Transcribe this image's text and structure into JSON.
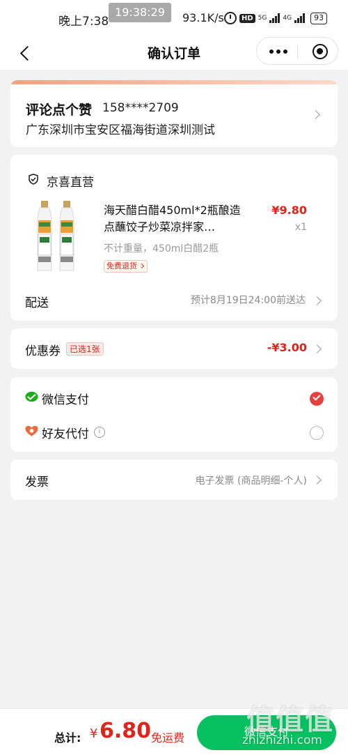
{
  "status_bar": {
    "time": "晚上7:38",
    "recording_badge": "19:38:29",
    "net_speed": "93.1K/s",
    "hd_label": "HD",
    "network_5g": "5G",
    "network_4g": "4G",
    "battery": "93",
    "icons": [
      "alarm-icon",
      "hd-icon",
      "signal-icon",
      "battery-icon"
    ]
  },
  "nav": {
    "title": "确认订单",
    "icons": [
      "back-icon",
      "more-icon",
      "close-target-icon"
    ]
  },
  "address": {
    "name": "评论点个赞",
    "phone": "158****2709",
    "detail": "广东深圳市宝安区福海街道深圳测试"
  },
  "store": {
    "name": "京喜直营",
    "product": {
      "title": "海天醋白醋450ml*2瓶酿造点蘸饺子炒菜凉拌家…",
      "price": "¥9.80",
      "quantity": "x1",
      "spec": "不计重量，450ml白醋2瓶",
      "tag": "免费退货"
    },
    "shipping_label": "配送",
    "shipping_value": "预计8月19日24:00前送达"
  },
  "coupon": {
    "label": "优惠券",
    "badge": "已选1张",
    "value": "-¥3.00"
  },
  "payment": {
    "options": [
      {
        "label": "微信支付",
        "selected": true
      },
      {
        "label": "好友代付",
        "selected": false
      }
    ],
    "info_glyph": "i"
  },
  "invoice": {
    "label": "发票",
    "value": "电子发票 (商品明细-个人)"
  },
  "bottom": {
    "total_label": "总计:",
    "currency": "¥",
    "amount": "6.80",
    "shipping": "免运费",
    "pay_button": "微信支付"
  },
  "watermark": {
    "glyphs": "值值值",
    "url": "zhizhizhi.com"
  },
  "colors": {
    "accent_red": "#e2231a",
    "wechat_green": "#07c160",
    "background": "#f2f2f2"
  }
}
